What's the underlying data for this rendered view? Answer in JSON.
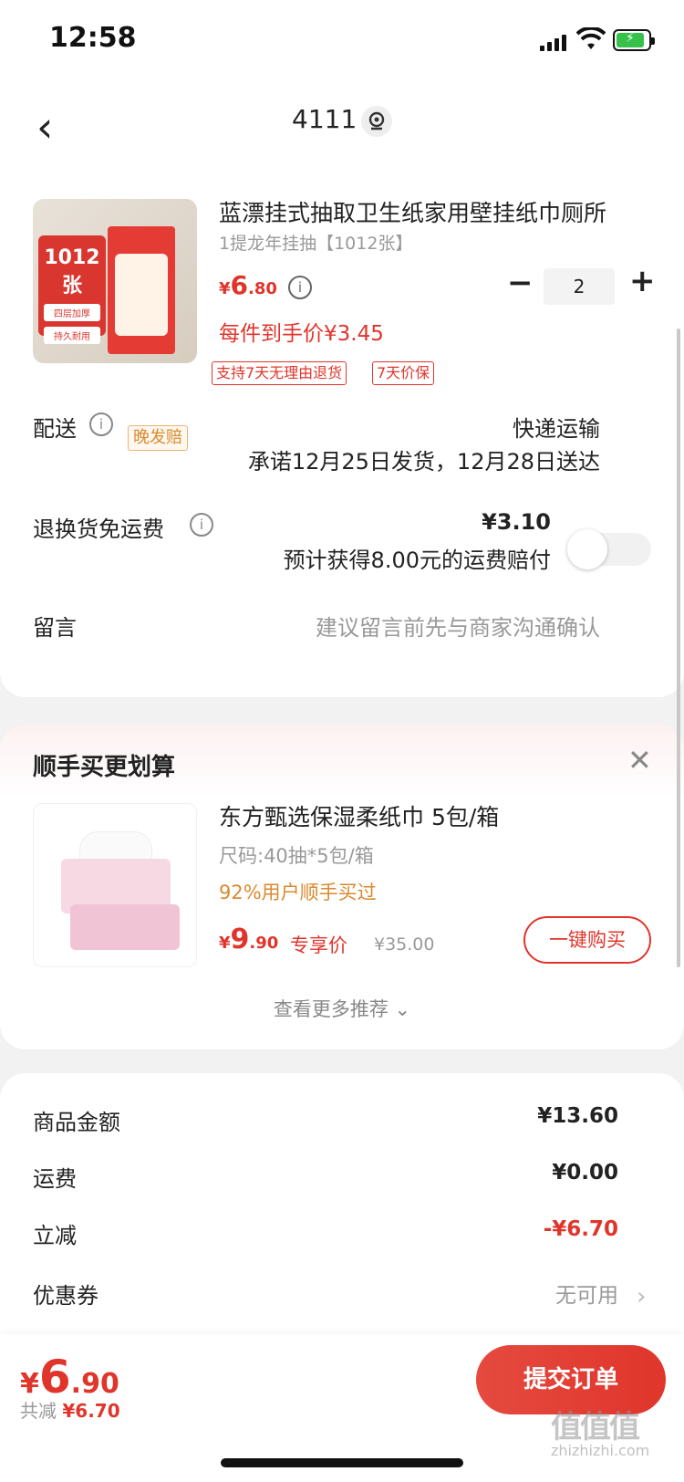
{
  "status_bar": {
    "time": "12:58"
  },
  "nav": {
    "title": "4111"
  },
  "product": {
    "title": "蓝漂挂式抽取卫生纸家用壁挂纸巾厕所",
    "sku": "1提龙年挂抽【1012张】",
    "price_currency": "¥",
    "price_int": "6",
    "price_dec": ".80",
    "quantity": "2",
    "each_price": "每件到手价¥3.45",
    "tags": [
      "支持7天无理由退货",
      "7天价保"
    ],
    "image_text": {
      "count": "1012张",
      "feature1": "四层加厚",
      "feature2": "持久耐用"
    }
  },
  "delivery": {
    "label": "配送",
    "badge": "晚发赔",
    "method": "快递运输",
    "promise": "承诺12月25日发货，12月28日送达"
  },
  "return_insurance": {
    "label": "退换货免运费",
    "price": "¥3.10",
    "desc": "预计获得8.00元的运费赔付",
    "enabled": false
  },
  "message": {
    "label": "留言",
    "placeholder": "建议留言前先与商家沟通确认"
  },
  "recommend": {
    "title": "顺手买更划算",
    "name": "东方甄选保湿柔纸巾 5包/箱",
    "spec": "尺码:40抽*5包/箱",
    "percent": "92%用户顺手买过",
    "price_currency": "¥",
    "price_int": "9",
    "price_dec": ".90",
    "exclusive": "专享价",
    "original": "¥35.00",
    "buy_label": "一键购买",
    "more_label": "查看更多推荐 ⌄"
  },
  "summary": {
    "goods_label": "商品金额",
    "goods_value": "¥13.60",
    "shipping_label": "运费",
    "shipping_value": "¥0.00",
    "discount_label": "立减",
    "discount_value": "-¥6.70",
    "coupon_label": "优惠券",
    "coupon_value": "无可用"
  },
  "bottom": {
    "total_currency": "¥",
    "total_int": "6",
    "total_dec": ".90",
    "saved_label": "共减",
    "saved_value": "¥6.70",
    "submit_label": "提交订单"
  },
  "watermark": {
    "logo": "值值值",
    "url": "zhizhizhi.com"
  },
  "colors": {
    "accent": "#e0352b",
    "orange": "#d98a2e",
    "toggle_off": "#f1f1f1"
  }
}
